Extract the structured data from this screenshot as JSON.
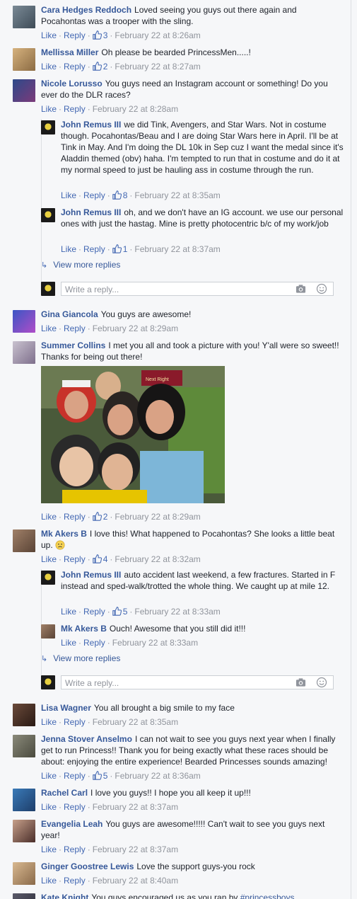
{
  "actions": {
    "like": "Like",
    "reply": "Reply"
  },
  "comments": [
    {
      "name": "Cara Hedges Reddoch",
      "text": "Loved seeing you guys out there again and Pocahontas was a trooper with the sling.",
      "likes": "3",
      "time": "February 22 at 8:26am"
    },
    {
      "name": "Mellissa Miller",
      "text": "Oh please be bearded PrincessMen.....!",
      "likes": "2",
      "time": "February 22 at 8:27am"
    },
    {
      "name": "Nicole Lorusso",
      "text": "You guys need an Instagram account or something! Do you ever do the DLR races?",
      "time": "February 22 at 8:28am"
    },
    {
      "name": "John Remus III",
      "text": "we did Tink, Avengers, and Star Wars. Not in costume though. Pocahontas/Beau and I are doing Star Wars here in April. I'll be at Tink in May. And I'm doing the DL 10k in Sep cuz I want the medal since it's Aladdin themed (obv) haha. I'm tempted to run that in costume and do it at my normal speed to just be hauling ass in costume through the run.",
      "likes": "8",
      "time": "February 22 at 8:35am"
    },
    {
      "name": "John Remus III",
      "text": "oh, and we don't have an IG account. we use our personal ones with just the hastag. Mine is pretty photocentric b/c of my work/job",
      "likes": "1",
      "time": "February 22 at 8:37am"
    },
    {
      "name": "Gina Giancola",
      "text": "You guys are awesome!",
      "time": "February 22 at 8:29am"
    },
    {
      "name": "Summer Collins",
      "text": "I met you all and took a picture with you! Y'all were so sweet!! Thanks for being out there!",
      "likes": "2",
      "time": "February 22 at 8:29am"
    },
    {
      "name": "Mk Akers B",
      "text": "I love this! What happened to Pocahontas? She looks a little beat up.",
      "likes": "4",
      "time": "February 22 at 8:32am"
    },
    {
      "name": "John Remus III",
      "text": "auto accident last weekend, a few fractures. Started in F instead and sped-walk/trotted the whole thing. We caught up at mile 12.",
      "likes": "5",
      "time": "February 22 at 8:33am"
    },
    {
      "name": "Mk Akers B",
      "text": "Ouch! Awesome that you still did it!!!",
      "time": "February 22 at 8:33am"
    },
    {
      "name": "Lisa Wagner",
      "text": "You all brought a big smile to my face",
      "time": "February 22 at 8:35am"
    },
    {
      "name": "Jenna Stover Anselmo",
      "text": "I can not wait to see you guys next year when I finally get to run Princess!! Thank you for being exactly what these races should be about: enjoying the entire experience! Bearded Princesses sounds amazing!",
      "likes": "5",
      "time": "February 22 at 8:36am"
    },
    {
      "name": "Rachel Carl",
      "text": "I love you guys!! I hope you all keep it up!!!",
      "time": "February 22 at 8:37am"
    },
    {
      "name": "Evangelia Leah",
      "text": "You guys are awesome!!!!! Can't wait to see you guys next year!",
      "time": "February 22 at 8:37am"
    },
    {
      "name": "Ginger Goostree Lewis",
      "text": "Love the support guys-you rock",
      "time": "February 22 at 8:40am"
    },
    {
      "name": "Kate Knight",
      "text": "You guys encouraged us as you ran by",
      "hashtag": "#princessboys"
    }
  ],
  "view_more": "View more replies",
  "write_placeholder": "Write a reply...",
  "photo_sign": "Next Right",
  "icons": {
    "thumb": "thumbs-up-icon",
    "camera": "camera-icon",
    "smiley": "smiley-icon",
    "arrow": "reply-arrow-icon",
    "emoji": "frowning-emoji-icon"
  },
  "colors": {
    "name": "#365899",
    "link": "#4267b2",
    "meta": "#90949c",
    "bg": "#f6f7f9",
    "border": "#dddfe2"
  }
}
